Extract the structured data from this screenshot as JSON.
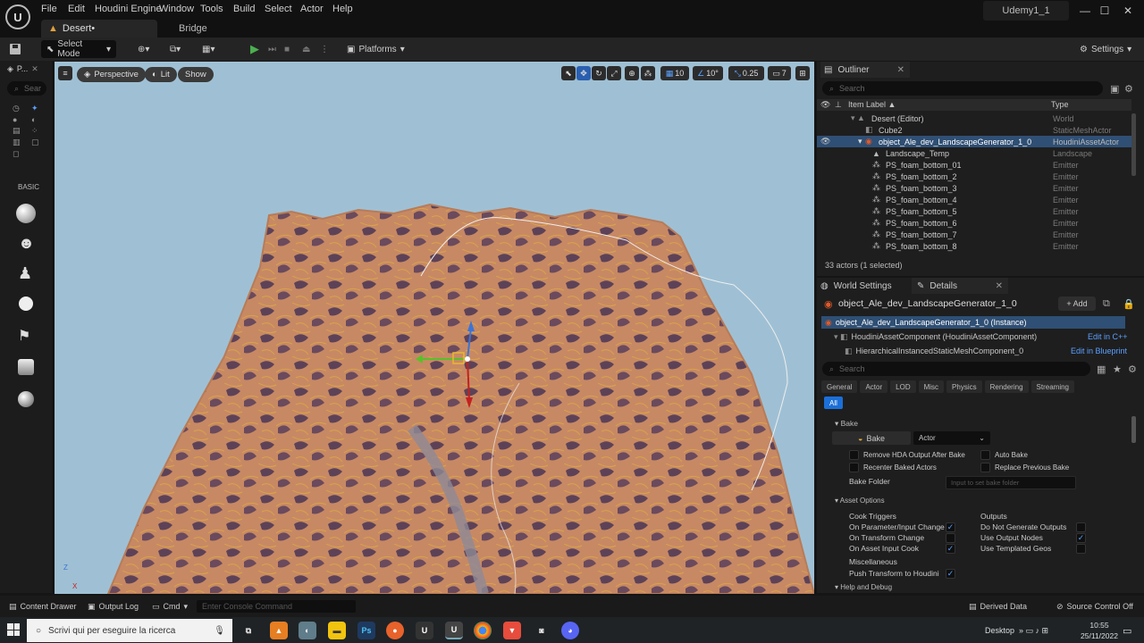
{
  "titlebar": {
    "menus": [
      "File",
      "Edit",
      "Houdini Engine",
      "Window",
      "Tools",
      "Build",
      "Select",
      "Actor",
      "Help"
    ],
    "level_tab": "Desert•",
    "bridge_tab": "Bridge",
    "project": "Udemy1_1",
    "min": "—",
    "max": "☐",
    "close": "✕"
  },
  "toolbar": {
    "select_mode": "Select Mode",
    "platforms": "Platforms",
    "settings": "Settings"
  },
  "leftpanel": {
    "tab": "P...",
    "search_placeholder": "Sear",
    "category": "BASIC"
  },
  "viewport": {
    "perspective": "Perspective",
    "lit": "Lit",
    "show": "Show",
    "grid_snap": "10",
    "rot_snap": "10°",
    "scale_snap": "0.25",
    "cam_speed": "7",
    "axis_z": "Z",
    "axis_x": "X",
    "sky_color": "#9fc0d4",
    "terrain_color": "#c78964"
  },
  "outliner": {
    "title": "Outliner",
    "search_placeholder": "Search",
    "col_label": "Item Label ▲",
    "col_type": "Type",
    "rows": [
      {
        "label": "Desert (Editor)",
        "type": "World"
      },
      {
        "label": "Cube2",
        "type": "StaticMeshActor"
      },
      {
        "label": "object_Ale_dev_LandscapeGenerator_1_0",
        "type": "HoudiniAssetActor"
      },
      {
        "label": "Landscape_Temp",
        "type": "Landscape"
      },
      {
        "label": "PS_foam_bottom_01",
        "type": "Emitter"
      },
      {
        "label": "PS_foam_bottom_2",
        "type": "Emitter"
      },
      {
        "label": "PS_foam_bottom_3",
        "type": "Emitter"
      },
      {
        "label": "PS_foam_bottom_4",
        "type": "Emitter"
      },
      {
        "label": "PS_foam_bottom_5",
        "type": "Emitter"
      },
      {
        "label": "PS_foam_bottom_6",
        "type": "Emitter"
      },
      {
        "label": "PS_foam_bottom_7",
        "type": "Emitter"
      },
      {
        "label": "PS_foam_bottom_8",
        "type": "Emitter"
      }
    ],
    "count": "33 actors (1 selected)"
  },
  "details": {
    "world_settings_tab": "World Settings",
    "details_tab": "Details",
    "object_name": "object_Ale_dev_LandscapeGenerator_1_0",
    "add": "+ Add",
    "instance": "object_Ale_dev_LandscapeGenerator_1_0 (Instance)",
    "component1": "HoudiniAssetComponent (HoudiniAssetComponent)",
    "edit_cpp": "Edit in C++",
    "component2": "HierarchicalInstancedStaticMeshComponent_0",
    "edit_bp": "Edit in Blueprint",
    "search_placeholder": "Search",
    "categories": [
      "General",
      "Actor",
      "LOD",
      "Misc",
      "Physics",
      "Rendering",
      "Streaming"
    ],
    "all": "All",
    "bake_section": "Bake",
    "bake_button": "Bake",
    "bake_type": "Actor",
    "remove_hda": "Remove HDA Output After Bake",
    "auto_bake": "Auto Bake",
    "recenter": "Recenter Baked Actors",
    "replace_prev": "Replace Previous Bake",
    "bake_folder": "Bake Folder",
    "bake_folder_placeholder": "Input to set bake folder",
    "asset_options": "Asset Options",
    "cook_triggers": "Cook Triggers",
    "on_param": "On Parameter/Input Change",
    "on_transform": "On Transform Change",
    "on_asset_input": "On Asset Input Cook",
    "outputs": "Outputs",
    "no_gen_outputs": "Do Not Generate Outputs",
    "use_output_nodes": "Use Output Nodes",
    "use_templated": "Use Templated Geos",
    "misc": "Miscellaneous",
    "push_transform": "Push Transform to Houdini",
    "help_debug": "Help and Debug"
  },
  "statusbar": {
    "content_drawer": "Content Drawer",
    "output_log": "Output Log",
    "cmd": "Cmd",
    "console_placeholder": "Enter Console Command",
    "derived_data": "Derived Data",
    "source_control": "Source Control Off"
  },
  "taskbar": {
    "search": "Scrivi qui per eseguire la ricerca",
    "desktop": "Desktop",
    "time": "10:55",
    "date": "25/11/2022"
  }
}
